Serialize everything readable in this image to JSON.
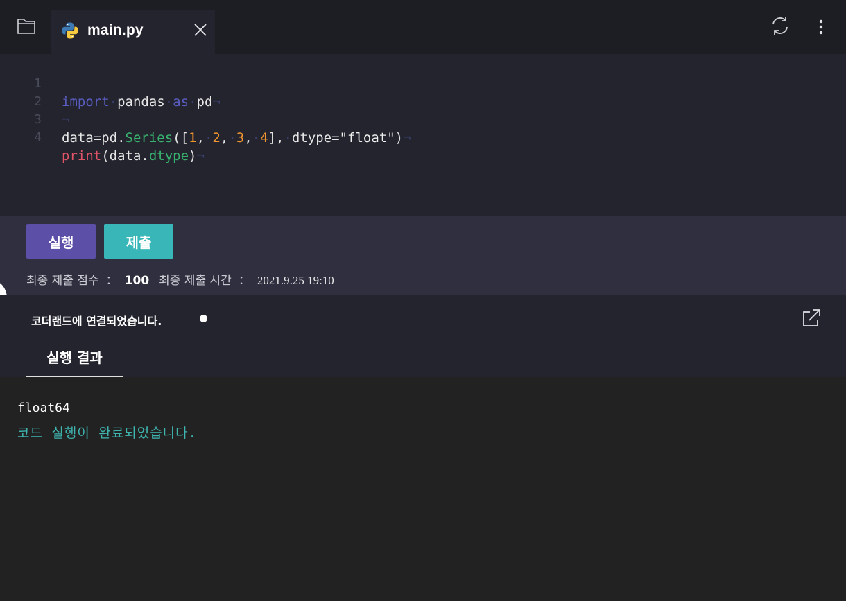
{
  "header": {
    "tab_label": "main.py",
    "icons": [
      "folder-icon",
      "python-icon",
      "close-icon",
      "refresh-icon",
      "more-vertical-icon"
    ]
  },
  "editor": {
    "lines": [
      {
        "number": "1",
        "text": "import pandas as pd"
      },
      {
        "number": "2",
        "text": ""
      },
      {
        "number": "3",
        "text": "data=pd.Series([1, 2, 3, 4], dtype=\"float\")"
      },
      {
        "number": "4",
        "text": "print(data.dtype)"
      }
    ],
    "line_end_mark": "¬",
    "space_mark": "·"
  },
  "actions": {
    "run_label": "실행",
    "submit_label": "제출",
    "score_label": "최종 제출 점수",
    "score_value": "100",
    "time_label": "최종 제출 시간",
    "time_value": "2021.9.25 19:10",
    "separator": "："
  },
  "status": {
    "connection_text": "코더랜드에 연결되었습니다.",
    "result_tab_label": "실행 결과"
  },
  "output": {
    "result": "float64",
    "message": "코드 실행이 완료되었습니다."
  },
  "colors": {
    "run_button": "#5b4fa8",
    "submit_button": "#38b6b8",
    "keyword": "#5a5dc0",
    "builtin_function": "#e05468",
    "method": "#38b36f",
    "number": "#f0952f",
    "output_message": "#3fb5b0"
  }
}
